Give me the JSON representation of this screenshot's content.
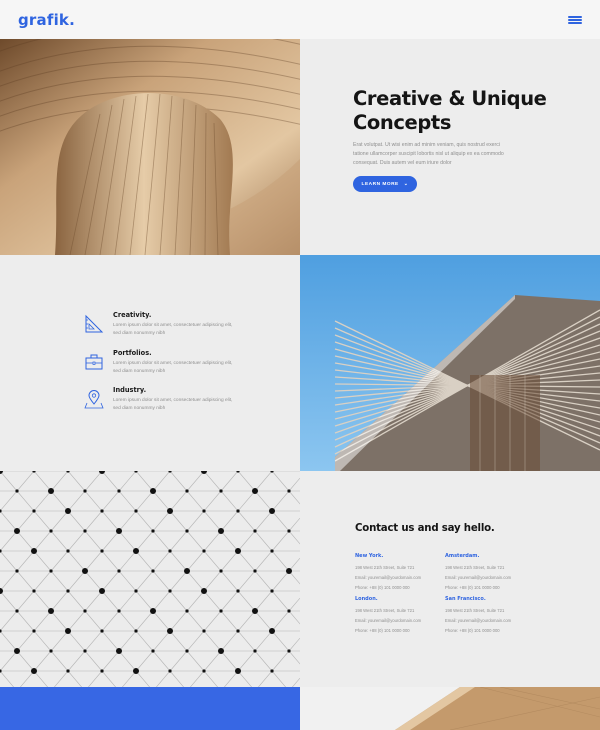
{
  "header": {
    "logo": "grafik.",
    "menu_icon": "hamburger-menu-icon",
    "accent": "#2f64e0"
  },
  "hero": {
    "title": "Creative & Unique Concepts",
    "text": "Erat volutpat. Ut wisi enim ad minim veniam, quis nostrud exerci tatione ullamcorper suscipit lobortis nisl ut aliquip ex ea commodo consequat. Duis autem vel eum iriure dolor",
    "button_label": "LEARN MORE",
    "button_icon": "chevron-down-icon"
  },
  "features": [
    {
      "title": "Creativity.",
      "text": "Lorem ipsum dolor sit amet, consectetuer adipiscing elit, sed diam nonummy nibh",
      "icon": "ruler-triangle-icon"
    },
    {
      "title": "Portfolios.",
      "text": "Lorem ipsum dolor sit amet, consectetuer adipiscing elit, sed diam nonummy nibh",
      "icon": "briefcase-icon"
    },
    {
      "title": "Industry.",
      "text": "Lorem ipsum dolor sit amet, consectetuer adipiscing elit, sed diam nonummy nibh",
      "icon": "map-pin-icon"
    }
  ],
  "contact": {
    "title": "Contact us and say hello.",
    "offices": [
      {
        "city": "New York.",
        "address": "198 West 21th Street, Suite 721",
        "email": "Email: youremail@yourdomain.com",
        "phone": "Phone: +88 (0) 101 0000 000"
      },
      {
        "city": "Amsterdam.",
        "address": "198 West 21th Street, Suite 721",
        "email": "Email: youremail@yourdomain.com",
        "phone": "Phone: +88 (0) 101 0000 000"
      },
      {
        "city": "London.",
        "address": "198 West 21th Street, Suite 721",
        "email": "Email: youremail@yourdomain.com",
        "phone": "Phone: +88 (0) 101 0000 000"
      },
      {
        "city": "San Francisco.",
        "address": "198 West 21th Street, Suite 721",
        "email": "Email: youremail@yourdomain.com",
        "phone": "Phone: +88 (0) 101 0000 000"
      }
    ]
  },
  "colors": {
    "accent_blue": "#2f64e0",
    "panel_gray": "#ededed",
    "wood": "#b58b5d",
    "sky": "#5ea8e2"
  }
}
